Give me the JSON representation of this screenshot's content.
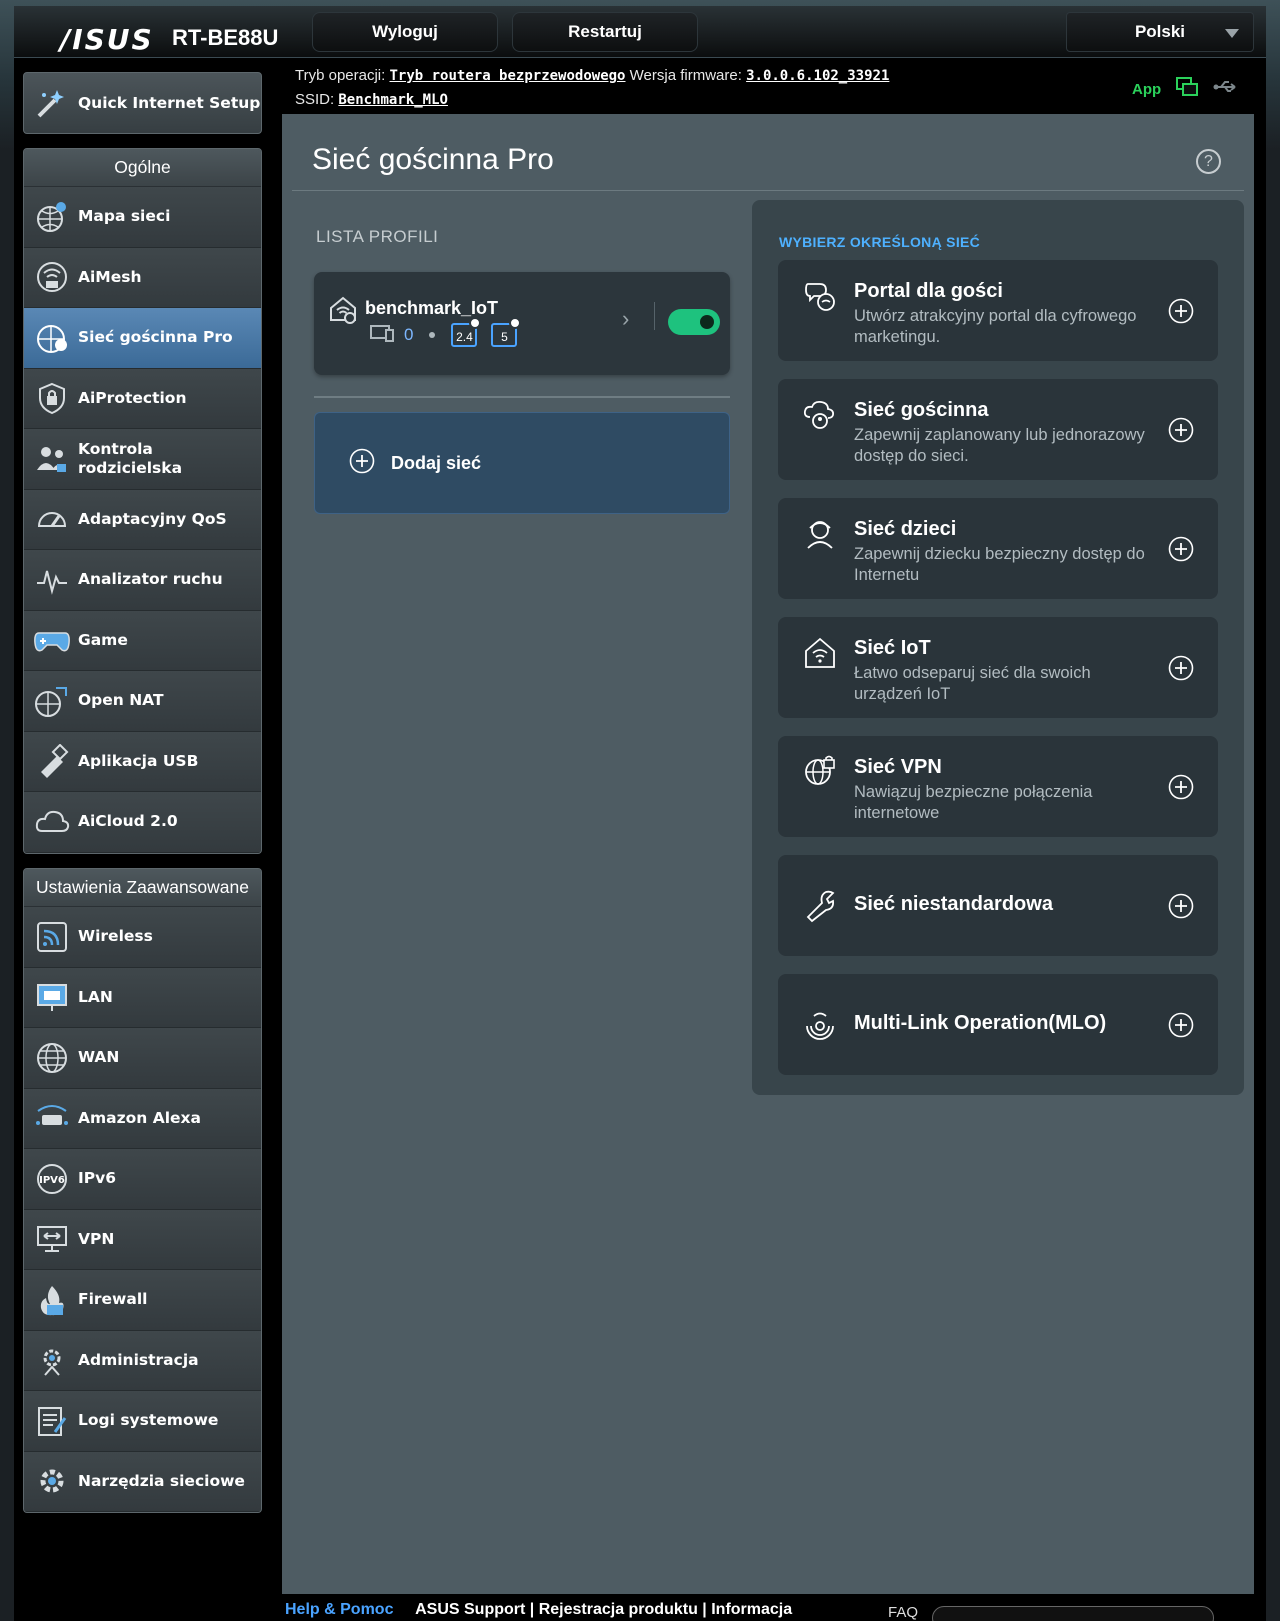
{
  "header": {
    "brand": "/ISUS",
    "model": "RT-BE88U",
    "logout_label": "Wyloguj",
    "restart_label": "Restartuj",
    "language": "Polski"
  },
  "infobar": {
    "mode_label": "Tryb operacji:",
    "mode_value": "Tryb routera bezprzewodowego",
    "firmware_label": "Wersja firmware:",
    "firmware_value": "3.0.0.6.102_33921",
    "ssid_label": "SSID:",
    "ssid_value": "Benchmark_MLO",
    "app_label": "App"
  },
  "sidebar": {
    "qis_label": "Quick Internet Setup",
    "general_title": "Ogólne",
    "general_items": [
      {
        "label": "Mapa sieci",
        "icon": "network-map-icon"
      },
      {
        "label": "AiMesh",
        "icon": "aimesh-icon"
      },
      {
        "label": "Sieć gościnna Pro",
        "icon": "guest-network-icon",
        "active": true
      },
      {
        "label": "AiProtection",
        "icon": "shield-icon"
      },
      {
        "label": "Kontrola rodzicielska",
        "icon": "parental-control-icon"
      },
      {
        "label": "Adaptacyjny QoS",
        "icon": "qos-gauge-icon"
      },
      {
        "label": "Analizator ruchu",
        "icon": "traffic-analyzer-icon"
      },
      {
        "label": "Game",
        "icon": "gamepad-icon"
      },
      {
        "label": "Open NAT",
        "icon": "open-nat-icon"
      },
      {
        "label": "Aplikacja USB",
        "icon": "usb-app-icon"
      },
      {
        "label": "AiCloud 2.0",
        "icon": "cloud-icon"
      }
    ],
    "advanced_title": "Ustawienia Zaawansowane",
    "advanced_items": [
      {
        "label": "Wireless",
        "icon": "wireless-icon"
      },
      {
        "label": "LAN",
        "icon": "lan-icon"
      },
      {
        "label": "WAN",
        "icon": "wan-globe-icon"
      },
      {
        "label": "Amazon Alexa",
        "icon": "alexa-icon"
      },
      {
        "label": "IPv6",
        "icon": "ipv6-icon"
      },
      {
        "label": "VPN",
        "icon": "vpn-icon"
      },
      {
        "label": "Firewall",
        "icon": "firewall-icon"
      },
      {
        "label": "Administracja",
        "icon": "admin-gear-icon"
      },
      {
        "label": "Logi systemowe",
        "icon": "system-log-icon"
      },
      {
        "label": "Narzędzia sieciowe",
        "icon": "network-tools-icon"
      }
    ]
  },
  "main": {
    "title": "Sieć gościnna Pro",
    "help": "?",
    "profiles_label": "LISTA PROFILI",
    "profile": {
      "name": "benchmark_IoT",
      "clients": "0",
      "band_24": "2.4",
      "band_5": "5",
      "enabled": true
    },
    "add_label": "Dodaj sieć",
    "right_title": "WYBIERZ OKREŚLONĄ SIEĆ",
    "networks": [
      {
        "title": "Portal dla gości",
        "desc": "Utwórz atrakcyjny portal dla cyfrowego marketingu.",
        "icon": "portal-icon"
      },
      {
        "title": "Sieć gościnna",
        "desc": "Zapewnij zaplanowany lub jednorazowy dostęp do sieci.",
        "icon": "guest-icon"
      },
      {
        "title": "Sieć dzieci",
        "desc": "Zapewnij dziecku bezpieczny dostęp do Internetu",
        "icon": "kids-icon"
      },
      {
        "title": "Sieć IoT",
        "desc": "Łatwo odseparuj sieć dla swoich urządzeń IoT",
        "icon": "iot-home-icon"
      },
      {
        "title": "Sieć VPN",
        "desc": "Nawiązuj bezpieczne połączenia internetowe",
        "icon": "vpn-globe-lock-icon"
      },
      {
        "title": "Sieć niestandardowa",
        "desc": "",
        "icon": "wrench-icon"
      },
      {
        "title": "Multi-Link Operation(MLO)",
        "desc": "",
        "icon": "mlo-icon"
      }
    ]
  },
  "footer": {
    "help": "Help & Pomoc",
    "links": "ASUS Support | Rejestracja produktu | Informacja",
    "faq": "FAQ"
  }
}
